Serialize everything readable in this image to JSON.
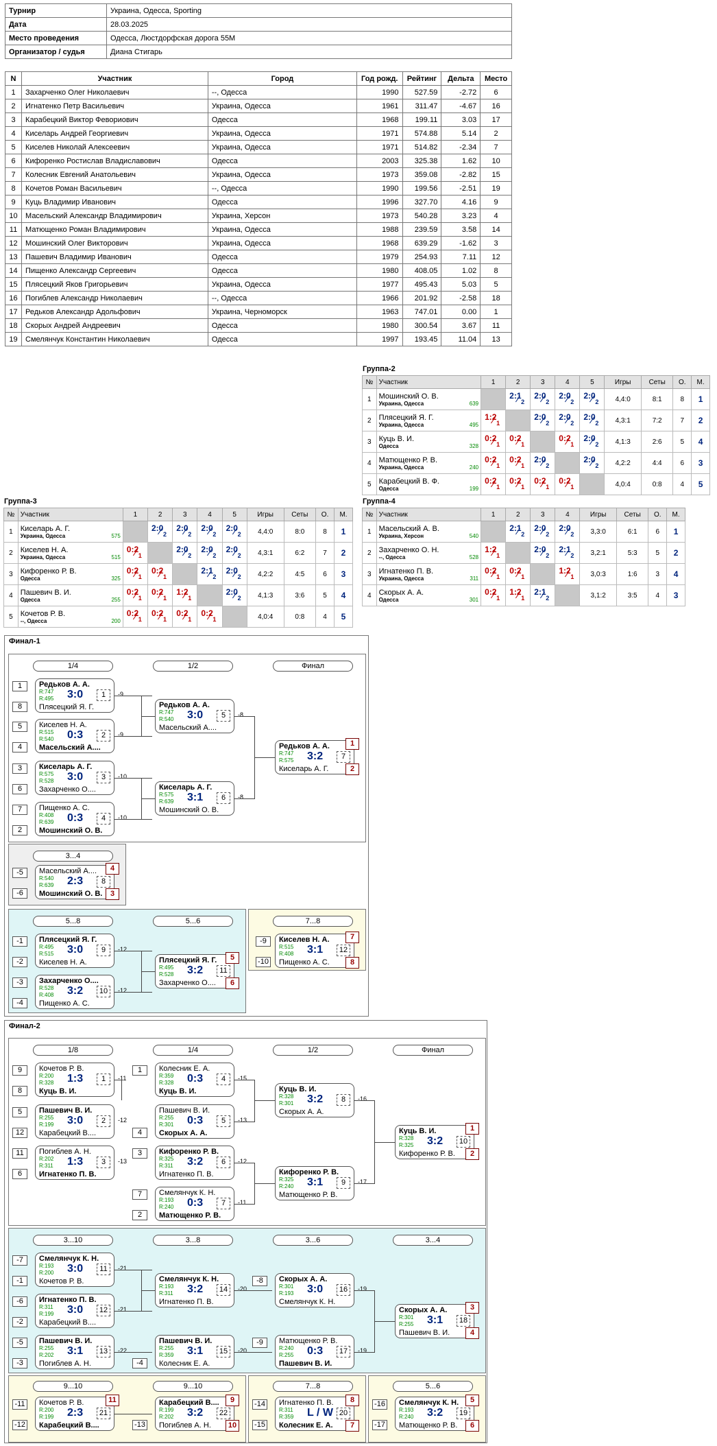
{
  "info": [
    {
      "label": "Турнир",
      "value": "Украина, Одесса, Sporting"
    },
    {
      "label": "Дата",
      "value": "28.03.2025"
    },
    {
      "label": "Место проведения",
      "value": "Одесса, Люстдорфская дорога 55М"
    },
    {
      "label": "Организатор / судья",
      "value": "Диана Стигарь"
    }
  ],
  "players_header": [
    "N",
    "Участник",
    "Город",
    "Год рожд.",
    "Рейтинг",
    "Дельта",
    "Место"
  ],
  "players": [
    [
      "1",
      "Захарченко Олег Николаевич",
      "--, Одесса",
      "1990",
      "527.59",
      "-2.72",
      "6"
    ],
    [
      "2",
      "Игнатенко Петр Васильевич",
      "Украина, Одесса",
      "1961",
      "311.47",
      "-4.67",
      "16"
    ],
    [
      "3",
      "Карабецкий Виктор Февориович",
      "Одесса",
      "1968",
      "199.11",
      "3.03",
      "17"
    ],
    [
      "4",
      "Киселарь Андрей Георгиевич",
      "Украина, Одесса",
      "1971",
      "574.88",
      "5.14",
      "2"
    ],
    [
      "5",
      "Киселев Николай Алексеевич",
      "Украина, Одесса",
      "1971",
      "514.82",
      "-2.34",
      "7"
    ],
    [
      "6",
      "Кифоренко Ростислав Владиславович",
      "Одесса",
      "2003",
      "325.38",
      "1.62",
      "10"
    ],
    [
      "7",
      "Колесник Евгений Анатольевич",
      "Украина, Одесса",
      "1973",
      "359.08",
      "-2.82",
      "15"
    ],
    [
      "8",
      "Кочетов Роман Васильевич",
      "--, Одесса",
      "1990",
      "199.56",
      "-2.51",
      "19"
    ],
    [
      "9",
      "Куць Владимир Иванович",
      "Одесса",
      "1996",
      "327.70",
      "4.16",
      "9"
    ],
    [
      "10",
      "Масельский Александр Владимирович",
      "Украина, Херсон",
      "1973",
      "540.28",
      "3.23",
      "4"
    ],
    [
      "11",
      "Матющенко Роман Владимирович",
      "Украина, Одесса",
      "1988",
      "239.59",
      "3.58",
      "14"
    ],
    [
      "12",
      "Мошинский Олег Викторович",
      "Украина, Одесса",
      "1968",
      "639.29",
      "-1.62",
      "3"
    ],
    [
      "13",
      "Пашевич Владимир Иванович",
      "Одесса",
      "1979",
      "254.93",
      "7.11",
      "12"
    ],
    [
      "14",
      "Пищенко Александр Сергеевич",
      "Одесса",
      "1980",
      "408.05",
      "1.02",
      "8"
    ],
    [
      "15",
      "Плясецкий Яков Григорьевич",
      "Украина, Одесса",
      "1977",
      "495.43",
      "5.03",
      "5"
    ],
    [
      "16",
      "Погиблев Александр Николаевич",
      "--, Одесса",
      "1966",
      "201.92",
      "-2.58",
      "18"
    ],
    [
      "17",
      "Редьков Александр Адольфович",
      "Украина, Черноморск",
      "1963",
      "747.01",
      "0.00",
      "1"
    ],
    [
      "18",
      "Скорых Андрей Андреевич",
      "Одесса",
      "1980",
      "300.54",
      "3.67",
      "11"
    ],
    [
      "19",
      "Смелянчук Константин Николаевич",
      "Одесса",
      "1997",
      "193.45",
      "11.04",
      "13"
    ]
  ],
  "group_header": [
    "№",
    "Участник",
    "1",
    "2",
    "3",
    "4",
    "5",
    "Игры",
    "Сеты",
    "О.",
    "М."
  ],
  "groups": [
    {
      "title": "Группа-2",
      "rows": [
        {
          "n": "1",
          "name": "Мошинский О. В.",
          "city": "Украина, Одесса",
          "rating": "639",
          "res": [
            "",
            "2:1",
            "2:0",
            "2:0",
            "2:0"
          ],
          "games": "4,4:0",
          "sets": "8:1",
          "pts": "8",
          "place": "1"
        },
        {
          "n": "2",
          "name": "Плясецкий Я. Г.",
          "city": "Украина, Одесса",
          "rating": "495",
          "res": [
            "1:2",
            "",
            "2:0",
            "2:0",
            "2:0"
          ],
          "games": "4,3:1",
          "sets": "7:2",
          "pts": "7",
          "place": "2"
        },
        {
          "n": "3",
          "name": "Куць В. И.",
          "city": "Одесса",
          "rating": "328",
          "res": [
            "0:2",
            "0:2",
            "",
            "0:2",
            "2:0"
          ],
          "games": "4,1:3",
          "sets": "2:6",
          "pts": "5",
          "place": "4"
        },
        {
          "n": "4",
          "name": "Матющенко Р. В.",
          "city": "Украина, Одесса",
          "rating": "240",
          "res": [
            "0:2",
            "0:2",
            "2:0",
            "",
            "2:0"
          ],
          "games": "4,2:2",
          "sets": "4:4",
          "pts": "6",
          "place": "3"
        },
        {
          "n": "5",
          "name": "Карабецкий В. Ф.",
          "city": "Одесса",
          "rating": "199",
          "res": [
            "0:2",
            "0:2",
            "0:2",
            "0:2",
            ""
          ],
          "games": "4,0:4",
          "sets": "0:8",
          "pts": "4",
          "place": "5"
        }
      ]
    },
    {
      "title": "Группа-3",
      "rows": [
        {
          "n": "1",
          "name": "Киселарь А. Г.",
          "city": "Украина, Одесса",
          "rating": "575",
          "res": [
            "",
            "2:0",
            "2:0",
            "2:0",
            "2:0"
          ],
          "games": "4,4:0",
          "sets": "8:0",
          "pts": "8",
          "place": "1"
        },
        {
          "n": "2",
          "name": "Киселев Н. А.",
          "city": "Украина, Одесса",
          "rating": "515",
          "res": [
            "0:2",
            "",
            "2:0",
            "2:0",
            "2:0"
          ],
          "games": "4,3:1",
          "sets": "6:2",
          "pts": "7",
          "place": "2"
        },
        {
          "n": "3",
          "name": "Кифоренко Р. В.",
          "city": "Одесса",
          "rating": "325",
          "res": [
            "0:2",
            "0:2",
            "",
            "2:1",
            "2:0"
          ],
          "games": "4,2:2",
          "sets": "4:5",
          "pts": "6",
          "place": "3"
        },
        {
          "n": "4",
          "name": "Пашевич В. И.",
          "city": "Одесса",
          "rating": "255",
          "res": [
            "0:2",
            "0:2",
            "1:2",
            "",
            "2:0"
          ],
          "games": "4,1:3",
          "sets": "3:6",
          "pts": "5",
          "place": "4"
        },
        {
          "n": "5",
          "name": "Кочетов Р. В.",
          "city": "--, Одесса",
          "rating": "200",
          "res": [
            "0:2",
            "0:2",
            "0:2",
            "0:2",
            ""
          ],
          "games": "4,0:4",
          "sets": "0:8",
          "pts": "4",
          "place": "5"
        }
      ]
    },
    {
      "title": "Группа-4",
      "rows": [
        {
          "n": "1",
          "name": "Масельский А. В.",
          "city": "Украина, Херсон",
          "rating": "540",
          "res": [
            "",
            "2:1",
            "2:0",
            "2:0"
          ],
          "games": "3,3:0",
          "sets": "6:1",
          "pts": "6",
          "place": "1"
        },
        {
          "n": "2",
          "name": "Захарченко О. Н.",
          "city": "--, Одесса",
          "rating": "528",
          "res": [
            "1:2",
            "",
            "2:0",
            "2:1"
          ],
          "games": "3,2:1",
          "sets": "5:3",
          "pts": "5",
          "place": "2"
        },
        {
          "n": "3",
          "name": "Игнатенко П. В.",
          "city": "Украина, Одесса",
          "rating": "311",
          "res": [
            "0:2",
            "0:2",
            "",
            "1:2"
          ],
          "games": "3,0:3",
          "sets": "1:6",
          "pts": "3",
          "place": "4"
        },
        {
          "n": "4",
          "name": "Скорых А. А.",
          "city": "Одесса",
          "rating": "301",
          "res": [
            "0:2",
            "1:2",
            "2:1",
            ""
          ],
          "games": "3,1:2",
          "sets": "3:5",
          "pts": "4",
          "place": "3"
        }
      ]
    }
  ],
  "final1": {
    "title": "Финал-1",
    "rounds": [
      "1/4",
      "1/2",
      "Финал",
      "3...4",
      "5...8",
      "5...6",
      "7...8"
    ],
    "seeds": [
      "1",
      "8",
      "5",
      "4",
      "3",
      "6",
      "7",
      "2",
      "-5",
      "-6",
      "-1",
      "-2",
      "-3",
      "-4",
      "-9",
      "-10"
    ],
    "matches": [
      {
        "p1": "Редьков А. А.",
        "r1": "R:747",
        "r2": "R:495",
        "p2": "Плясецкий Я. Г.",
        "score": "3:0",
        "num": "1",
        "w": 1,
        "lose": "-9"
      },
      {
        "p1": "Киселев Н. А.",
        "r1": "R:515",
        "r2": "R:540",
        "p2": "Масельский А....",
        "score": "0:3",
        "num": "2",
        "w": 2,
        "lose": "-9"
      },
      {
        "p1": "Киселарь А. Г.",
        "r1": "R:575",
        "r2": "R:528",
        "p2": "Захарченко О....",
        "score": "3:0",
        "num": "3",
        "w": 1,
        "lose": "-10"
      },
      {
        "p1": "Пищенко А. С.",
        "r1": "R:408",
        "r2": "R:639",
        "p2": "Мошинский О. В.",
        "score": "0:3",
        "num": "4",
        "w": 2,
        "lose": "-10"
      },
      {
        "p1": "Редьков А. А.",
        "r1": "R:747",
        "r2": "R:540",
        "p2": "Масельский А....",
        "score": "3:0",
        "num": "5",
        "w": 1,
        "lose": "-8"
      },
      {
        "p1": "Киселарь А. Г.",
        "r1": "R:575",
        "r2": "R:639",
        "p2": "Мошинский О. В.",
        "score": "3:1",
        "num": "6",
        "w": 1,
        "lose": "-8"
      },
      {
        "p1": "Редьков А. А.",
        "r1": "R:747",
        "r2": "R:575",
        "p2": "Киселарь А. Г.",
        "score": "3:2",
        "num": "7",
        "w": 1,
        "place1": "1",
        "place2": "2"
      },
      {
        "p1": "Масельский А....",
        "r1": "R:540",
        "r2": "R:639",
        "p2": "Мошинский О. В.",
        "score": "2:3",
        "num": "8",
        "w": 2,
        "place1": "4",
        "place2": "3"
      },
      {
        "p1": "Плясецкий Я. Г.",
        "r1": "R:495",
        "r2": "R:515",
        "p2": "Киселев Н. А.",
        "score": "3:0",
        "num": "9",
        "w": 1,
        "lose": "-12"
      },
      {
        "p1": "Захарченко О....",
        "r1": "R:528",
        "r2": "R:408",
        "p2": "Пищенко А. С.",
        "score": "3:2",
        "num": "10",
        "w": 1,
        "lose": "-12"
      },
      {
        "p1": "Плясецкий Я. Г.",
        "r1": "R:495",
        "r2": "R:528",
        "p2": "Захарченко О....",
        "score": "3:2",
        "num": "11",
        "w": 1,
        "place1": "5",
        "place2": "6"
      },
      {
        "p1": "Киселев Н. А.",
        "r1": "R:515",
        "r2": "R:408",
        "p2": "Пищенко А. С.",
        "score": "3:1",
        "num": "12",
        "w": 1,
        "place1": "7",
        "place2": "8"
      }
    ]
  },
  "final2": {
    "title": "Финал-2",
    "rounds": [
      "1/8",
      "1/4",
      "1/2",
      "Финал",
      "3...10",
      "3...8",
      "3...6",
      "3...4",
      "9...10",
      "9...10",
      "7...8",
      "5...6"
    ],
    "seeds": [
      "9",
      "8",
      "5",
      "12",
      "11",
      "6",
      "1",
      "4",
      "3",
      "7",
      "2",
      "-7",
      "-1",
      "-6",
      "-2",
      "-5",
      "-3",
      "-4",
      "-8",
      "-9",
      "-11",
      "-12",
      "-13",
      "-14",
      "-15",
      "-16",
      "-17"
    ],
    "matches": [
      {
        "p1": "Кочетов Р. В.",
        "r1": "R:200",
        "r2": "R:328",
        "p2": "Куць В. И.",
        "score": "1:3",
        "num": "1",
        "w": 2,
        "lose": "-11"
      },
      {
        "p1": "Пашевич В. И.",
        "r1": "R:255",
        "r2": "R:199",
        "p2": "Карабецкий В....",
        "score": "3:0",
        "num": "2",
        "w": 1,
        "lose": "-12"
      },
      {
        "p1": "Погиблев А. Н.",
        "r1": "R:202",
        "r2": "R:311",
        "p2": "Игнатенко П. В.",
        "score": "1:3",
        "num": "3",
        "w": 2,
        "lose": "-13"
      },
      {
        "p1": "Колесник Е. А.",
        "r1": "R:359",
        "r2": "R:328",
        "p2": "Куць В. И.",
        "score": "0:3",
        "num": "4",
        "w": 2,
        "lose": "-15"
      },
      {
        "p1": "Пашевич В. И.",
        "r1": "R:255",
        "r2": "R:301",
        "p2": "Скорых А. А.",
        "score": "0:3",
        "num": "5",
        "w": 2,
        "lose": "-13"
      },
      {
        "p1": "Кифоренко Р. В.",
        "r1": "R:325",
        "r2": "R:311",
        "p2": "Игнатенко П. В.",
        "score": "3:2",
        "num": "6",
        "w": 1,
        "lose": "-12"
      },
      {
        "p1": "Смелянчук К. Н.",
        "r1": "R:193",
        "r2": "R:240",
        "p2": "Матющенко Р. В.",
        "score": "0:3",
        "num": "7",
        "w": 2,
        "lose": "-11"
      },
      {
        "p1": "Куць В. И.",
        "r1": "R:328",
        "r2": "R:301",
        "p2": "Скорых А. А.",
        "score": "3:2",
        "num": "8",
        "w": 1,
        "lose": "-16"
      },
      {
        "p1": "Кифоренко Р. В.",
        "r1": "R:325",
        "r2": "R:240",
        "p2": "Матющенко Р. В.",
        "score": "3:1",
        "num": "9",
        "w": 1,
        "lose": "-17"
      },
      {
        "p1": "Куць В. И.",
        "r1": "R:328",
        "r2": "R:325",
        "p2": "Кифоренко Р. В.",
        "score": "3:2",
        "num": "10",
        "w": 1,
        "place1": "1",
        "place2": "2"
      },
      {
        "p1": "Смелянчук К. Н.",
        "r1": "R:193",
        "r2": "R:200",
        "p2": "Кочетов Р. В.",
        "score": "3:0",
        "num": "11",
        "w": 1,
        "lose": "-21"
      },
      {
        "p1": "Игнатенко П. В.",
        "r1": "R:311",
        "r2": "R:199",
        "p2": "Карабецкий В....",
        "score": "3:0",
        "num": "12",
        "w": 1,
        "lose": "-21"
      },
      {
        "p1": "Пашевич В. И.",
        "r1": "R:255",
        "r2": "R:202",
        "p2": "Погиблев А. Н.",
        "score": "3:1",
        "num": "13",
        "w": 1,
        "lose": "-22"
      },
      {
        "p1": "Смелянчук К. Н.",
        "r1": "R:193",
        "r2": "R:311",
        "p2": "Игнатенко П. В.",
        "score": "3:2",
        "num": "14",
        "w": 1,
        "lose": "-20"
      },
      {
        "p1": "Пашевич В. И.",
        "r1": "R:255",
        "r2": "R:359",
        "p2": "Колесник Е. А.",
        "score": "3:1",
        "num": "15",
        "w": 1,
        "lose": "-20"
      },
      {
        "p1": "Скорых А. А.",
        "r1": "R:301",
        "r2": "R:193",
        "p2": "Смелянчук К. Н.",
        "score": "3:0",
        "num": "16",
        "w": 1,
        "lose": "-19"
      },
      {
        "p1": "Матющенко Р. В.",
        "r1": "R:240",
        "r2": "R:255",
        "p2": "Пашевич В. И.",
        "score": "0:3",
        "num": "17",
        "w": 2,
        "lose": "-19"
      },
      {
        "p1": "Скорых А. А.",
        "r1": "R:301",
        "r2": "R:255",
        "p2": "Пашевич В. И.",
        "score": "3:1",
        "num": "18",
        "w": 1,
        "place1": "3",
        "place2": "4"
      },
      {
        "p1": "Кочетов Р. В.",
        "r1": "R:200",
        "r2": "R:199",
        "p2": "Карабецкий В....",
        "score": "2:3",
        "num": "21",
        "w": 2,
        "place1": "11"
      },
      {
        "p1": "Карабецкий В....",
        "r1": "R:199",
        "r2": "R:202",
        "p2": "Погиблев А. Н.",
        "score": "3:2",
        "num": "22",
        "w": 1,
        "place1": "9",
        "place2": "10"
      },
      {
        "p1": "Игнатенко П. В.",
        "r1": "R:311",
        "r2": "R:359",
        "p2": "Колесник Е. А.",
        "score": "L / W",
        "num": "20",
        "w": 2,
        "place1": "8",
        "place2": "7"
      },
      {
        "p1": "Смелянчук К. Н.",
        "r1": "R:193",
        "r2": "R:240",
        "p2": "Матющенко Р. В.",
        "score": "3:2",
        "num": "19",
        "w": 1,
        "place1": "5",
        "place2": "6"
      }
    ]
  }
}
